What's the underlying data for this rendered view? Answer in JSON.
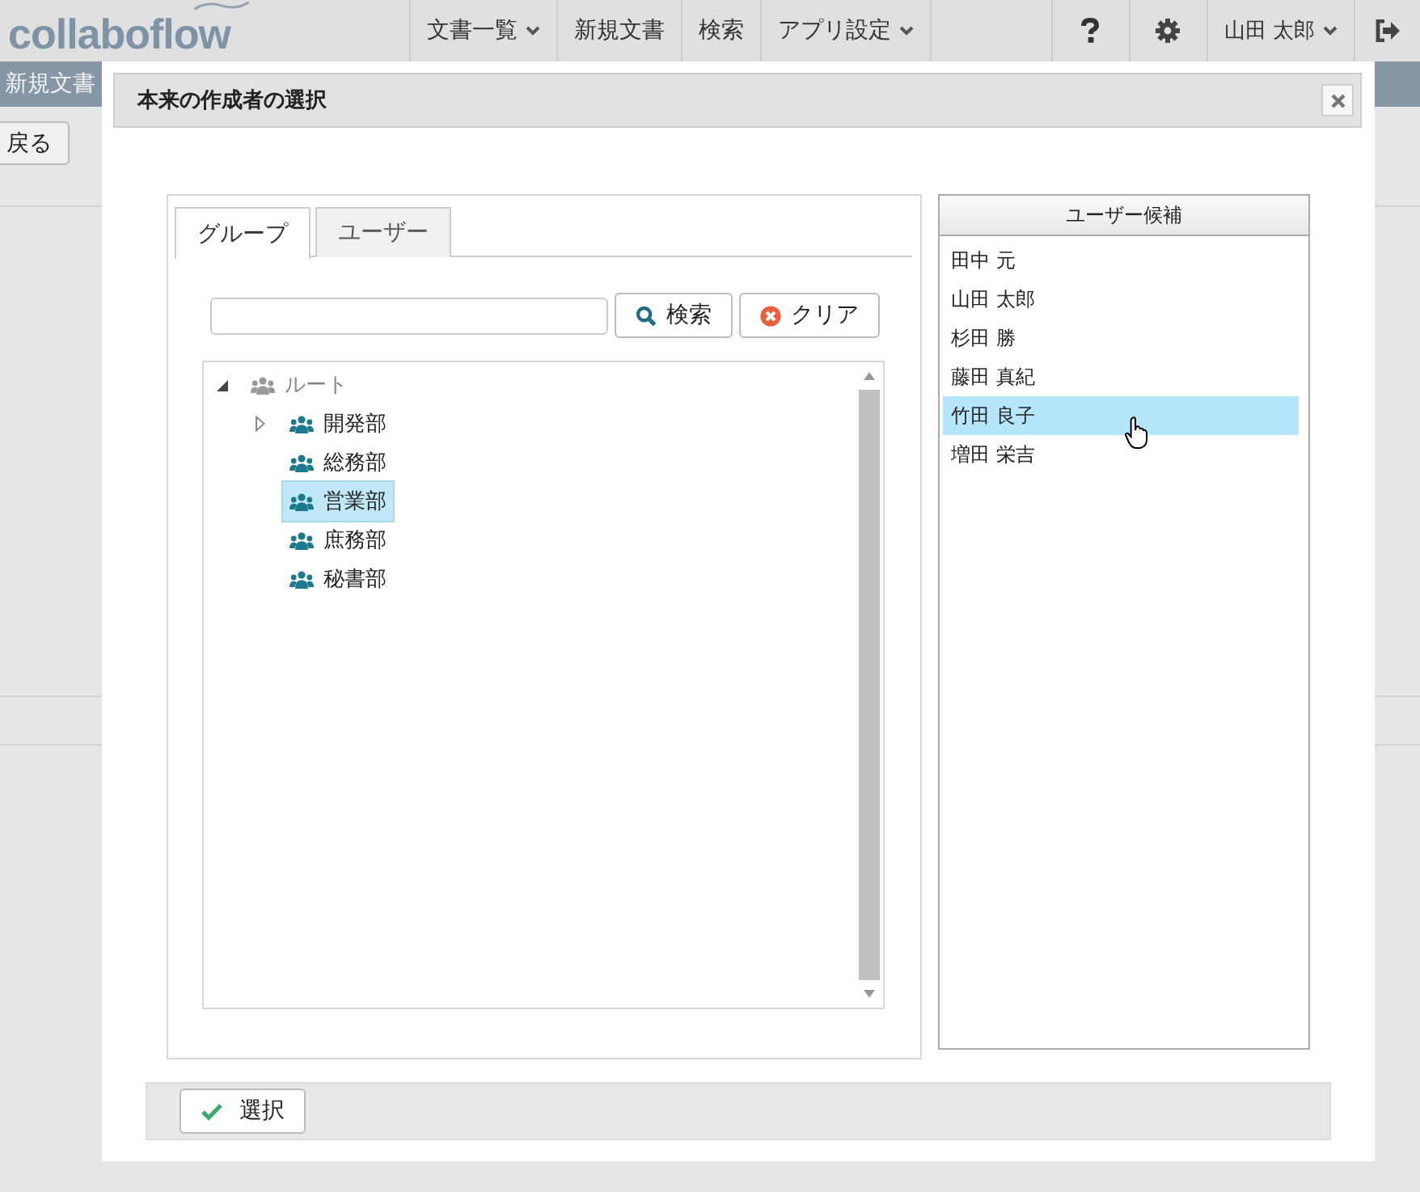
{
  "nav": {
    "logo": "collaboflow",
    "menu": [
      {
        "label": "文書一覧",
        "dropdown": true
      },
      {
        "label": "新規文書",
        "dropdown": false
      },
      {
        "label": "検索",
        "dropdown": false
      },
      {
        "label": "アプリ設定",
        "dropdown": true
      }
    ],
    "user": {
      "label": "山田 太郎",
      "dropdown": true
    }
  },
  "page": {
    "title": "新規文書",
    "back_button": "戻る"
  },
  "dialog": {
    "title": "本来の作成者の選択",
    "tabs": [
      {
        "label": "グループ",
        "selected": true
      },
      {
        "label": "ユーザー",
        "selected": false
      }
    ],
    "search": {
      "button": "検索",
      "clear": "クリア"
    },
    "tree": {
      "label": "ルート",
      "kind": "branch",
      "expanded": true,
      "selected": false,
      "children": [
        {
          "label": "開発部",
          "kind": "branch",
          "expanded": false,
          "selected": false
        },
        {
          "label": "総務部",
          "kind": "leaf",
          "selected": false
        },
        {
          "label": "営業部",
          "kind": "leaf",
          "selected": true
        },
        {
          "label": "庶務部",
          "kind": "leaf",
          "selected": false
        },
        {
          "label": "秘書部",
          "kind": "leaf",
          "selected": false
        }
      ]
    },
    "candidates": {
      "header": "ユーザー候補",
      "items": [
        {
          "name": "田中 元",
          "selected": false
        },
        {
          "name": "山田 太郎",
          "selected": false
        },
        {
          "name": "杉田 勝",
          "selected": false
        },
        {
          "name": "藤田 真紀",
          "selected": false
        },
        {
          "name": "竹田 良子",
          "selected": true
        },
        {
          "name": "増田 栄吉",
          "selected": false
        }
      ]
    },
    "submit": "選択"
  }
}
